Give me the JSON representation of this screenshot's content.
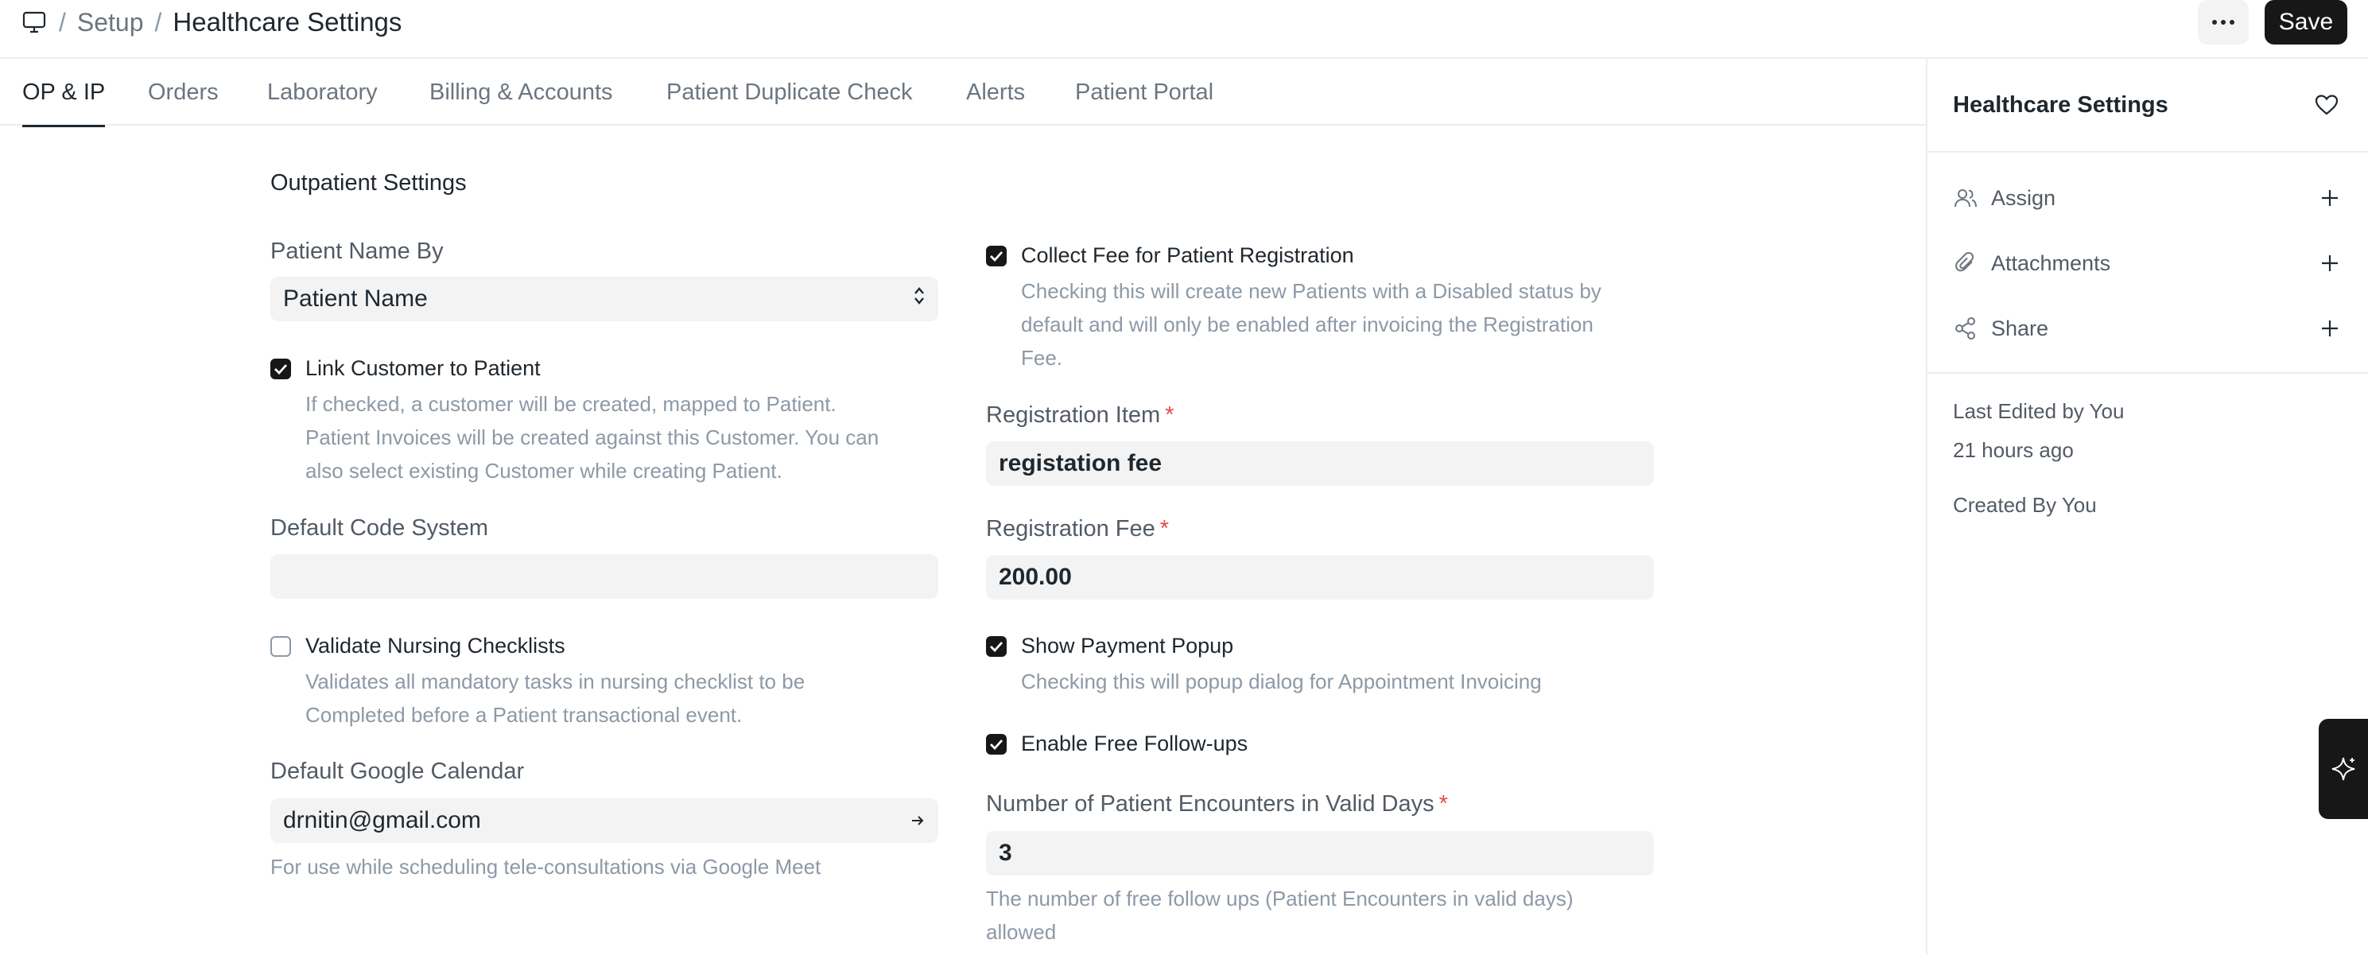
{
  "breadcrumb": {
    "sep": "/",
    "setup": "Setup",
    "title": "Healthcare Settings"
  },
  "header": {
    "more_label": "···",
    "save_label": "Save"
  },
  "tabs": [
    {
      "label": "OP & IP",
      "active": true
    },
    {
      "label": "Orders",
      "active": false
    },
    {
      "label": "Laboratory",
      "active": false
    },
    {
      "label": "Billing & Accounts",
      "active": false
    },
    {
      "label": "Patient Duplicate Check",
      "active": false
    },
    {
      "label": "Alerts",
      "active": false
    },
    {
      "label": "Patient Portal",
      "active": false
    }
  ],
  "sidebar": {
    "title": "Healthcare Settings",
    "actions": [
      {
        "label": "Assign",
        "icon": "users-icon"
      },
      {
        "label": "Attachments",
        "icon": "paperclip-icon"
      },
      {
        "label": "Share",
        "icon": "share-icon"
      }
    ],
    "last_edited": "Last Edited by You",
    "last_edited_time": "21 hours ago",
    "created_by": "Created By You"
  },
  "form": {
    "section_title": "Outpatient Settings",
    "patient_name_by": {
      "label": "Patient Name By",
      "value": "Patient Name"
    },
    "link_customer": {
      "label": "Link Customer to Patient",
      "checked": true,
      "desc": [
        "If checked, a customer will be created, mapped to Patient.",
        "Patient Invoices will be created against this Customer. You can",
        "also select existing Customer while creating Patient."
      ]
    },
    "default_code_system": {
      "label": "Default Code System",
      "value": ""
    },
    "validate_nursing": {
      "label": "Validate Nursing Checklists",
      "checked": false,
      "desc": [
        "Validates all mandatory tasks in nursing checklist to be",
        "Completed before a Patient transactional event."
      ]
    },
    "google_calendar": {
      "label": "Default Google Calendar",
      "value": "drnitin@gmail.com",
      "desc": "For use while scheduling tele-consultations via Google Meet"
    },
    "collect_fee": {
      "label": "Collect Fee for Patient Registration",
      "checked": true,
      "desc": [
        "Checking this will create new Patients with a Disabled status by",
        "default and will only be enabled after invoicing the Registration",
        "Fee."
      ]
    },
    "registration_item": {
      "label": "Registration Item",
      "required": "*",
      "value": "registation fee"
    },
    "registration_fee": {
      "label": "Registration Fee",
      "required": "*",
      "value": "200.00"
    },
    "show_payment_popup": {
      "label": "Show Payment Popup",
      "checked": true,
      "desc": "Checking this will popup dialog for Appointment Invoicing"
    },
    "free_followups": {
      "label": "Enable Free Follow-ups",
      "checked": true
    },
    "encounters": {
      "label": "Number of Patient Encounters in Valid Days",
      "required": "*",
      "value": "3",
      "desc": [
        "The number of free follow ups (Patient Encounters in valid days)",
        "allowed"
      ]
    }
  }
}
